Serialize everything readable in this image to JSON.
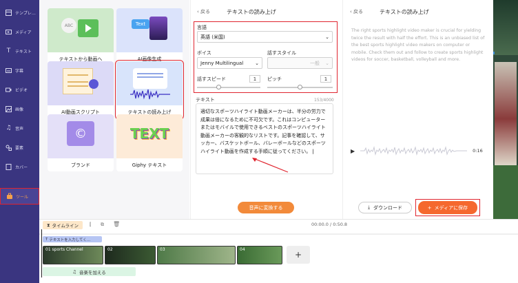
{
  "sidebar": {
    "items": [
      {
        "label": "テンプレ…",
        "icon": "template-icon"
      },
      {
        "label": "メディア",
        "icon": "media-icon"
      },
      {
        "label": "テキスト",
        "icon": "text-icon"
      },
      {
        "label": "字幕",
        "icon": "subtitle-icon"
      },
      {
        "label": "ビデオ",
        "icon": "video-icon"
      },
      {
        "label": "画像",
        "icon": "image-icon"
      },
      {
        "label": "音声",
        "icon": "music-icon"
      },
      {
        "label": "要素",
        "icon": "elements-icon"
      },
      {
        "label": "カバー",
        "icon": "cover-icon"
      },
      {
        "label": "ツール",
        "icon": "tools-icon"
      }
    ]
  },
  "tools": {
    "cards": [
      {
        "label": "テキストから動画へ"
      },
      {
        "label": "AI画像生成",
        "badge": "Text"
      },
      {
        "label": "AI動画スクリプト"
      },
      {
        "label": "テキストの読み上げ"
      },
      {
        "label": "ブランド"
      },
      {
        "label": "Giphy テキスト",
        "art": "TEXT"
      }
    ]
  },
  "tts": {
    "back": "戻る",
    "title": "テキストの読み上げ",
    "language_label": "言語",
    "language_value": "英語 (米国)",
    "voice_label": "ボイス",
    "voice_value": "Jenny Multilingual",
    "style_label": "話すスタイル",
    "style_value": "一般",
    "speed_label": "話すスピード",
    "speed_value": "1",
    "pitch_label": "ピッチ",
    "pitch_value": "1",
    "text_label": "テキスト",
    "char_count": "153/4000",
    "text_value": "適切なスポーツハイライト動画メーカーは、半分の労力で成果は倍になるために不可欠です。これはコンピューターまたはモバイルで使用できるベストのスポーツハイライト動画メーカーの客観的なリストです。記事を確認して、サッカー、バスケットボール、バレーボールなどのスポーツハイライト動画を作成する手順に従ってください。",
    "convert_button": "音声に変換する"
  },
  "result": {
    "back": "戻る",
    "title": "テキストの読み上げ",
    "preview_text": "The right sports highlight video maker is crucial for yielding twice the result with half the effort. This is an unbiased list of the best sports highlight video makers on computer or mobile. Check them out and follow to create sports highlight videos for soccer, basketball, volleyball and more.",
    "duration": "0:16",
    "download_button": "ダウンロード",
    "save_button": "メディアに保存"
  },
  "timeline": {
    "label": "タイムライン",
    "time": "00:00.0 / 0:50.8",
    "text_track": "テキストを入力してく...",
    "clips": [
      {
        "label": "01 sports Channel"
      },
      {
        "label": "02"
      },
      {
        "label": "03"
      },
      {
        "label": "04"
      }
    ],
    "music_track": "音楽を加える",
    "add": "+"
  },
  "colors": {
    "sidebar": "#3a3580",
    "accent_orange": "#f5682e",
    "highlight_red": "#e0242e"
  }
}
